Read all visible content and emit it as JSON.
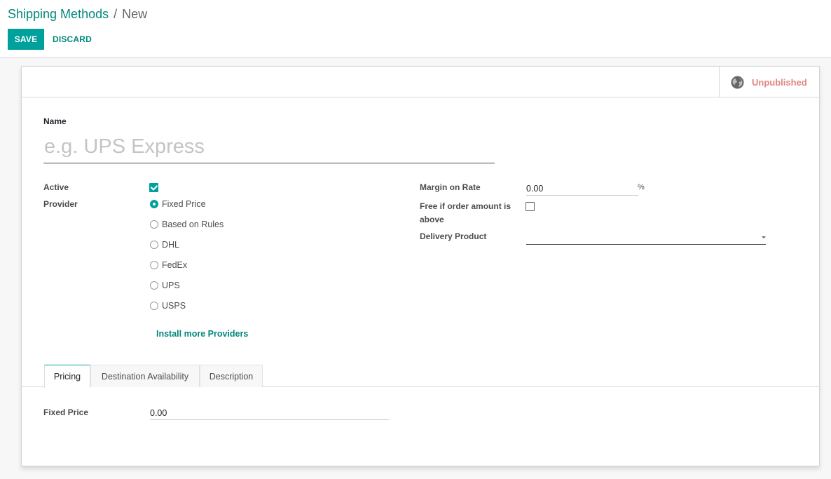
{
  "breadcrumb": {
    "parent": "Shipping Methods",
    "separator": "/",
    "current": "New"
  },
  "toolbar": {
    "save_label": "SAVE",
    "discard_label": "DISCARD"
  },
  "status": {
    "label": "Unpublished",
    "color": "#e08780",
    "icon": "globe-icon"
  },
  "name_field": {
    "label": "Name",
    "placeholder": "e.g. UPS Express",
    "value": ""
  },
  "left_group": {
    "active_label": "Active",
    "active_checked": true,
    "provider_label": "Provider",
    "providers": [
      {
        "label": "Fixed Price",
        "selected": true
      },
      {
        "label": "Based on Rules",
        "selected": false
      },
      {
        "label": "DHL",
        "selected": false
      },
      {
        "label": "FedEx",
        "selected": false
      },
      {
        "label": "UPS",
        "selected": false
      },
      {
        "label": "USPS",
        "selected": false
      }
    ],
    "install_link": "Install more Providers"
  },
  "right_group": {
    "margin_label": "Margin on Rate",
    "margin_value": "0.00",
    "margin_unit": "%",
    "free_label": "Free if order amount is above",
    "free_checked": false,
    "delivery_product_label": "Delivery Product",
    "delivery_product_value": ""
  },
  "tabs": [
    {
      "label": "Pricing",
      "active": true
    },
    {
      "label": "Destination Availability",
      "active": false
    },
    {
      "label": "Description",
      "active": false
    }
  ],
  "pricing": {
    "fixed_price_label": "Fixed Price",
    "fixed_price_value": "0.00"
  },
  "colors": {
    "accent": "#00a09d",
    "link": "#00897b"
  }
}
